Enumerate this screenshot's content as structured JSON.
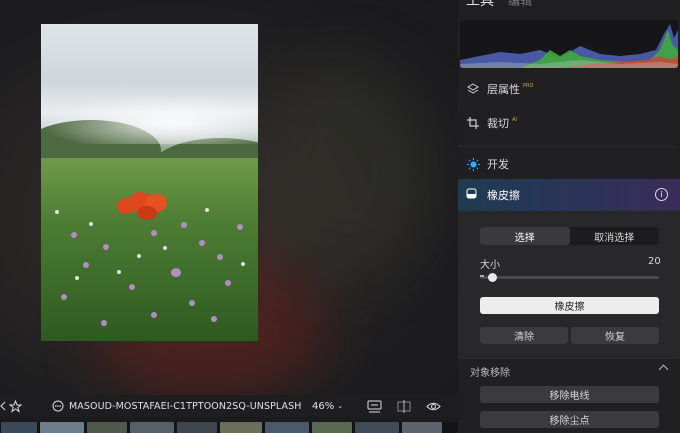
{
  "panel": {
    "title": "工具",
    "subtitle": "编辑",
    "menu": [
      {
        "label": "层属性",
        "badge": "PRO",
        "badge_color": "#d9a638",
        "icon": "layers-icon"
      },
      {
        "label": "裁切",
        "badge": "AI",
        "badge_color": "#d9a638",
        "icon": "crop-icon"
      },
      {
        "label": "开发",
        "badge": "",
        "icon": "sun-icon",
        "icon_color": "#3fa9f5"
      }
    ],
    "eraser": {
      "title": "橡皮擦",
      "icon": "eraser-icon",
      "info_icon": "info-icon",
      "select_tab": "选择",
      "deselect_tab": "取消选择",
      "size_label": "大小",
      "size_value": "20",
      "size_fraction": 0.07,
      "eraser_button": "橡皮擦",
      "clear_button": "清除",
      "restore_button": "恢复"
    },
    "object_removal": {
      "title": "对象移除",
      "remove_wires": "移除电线",
      "remove_dust": "移除尘点"
    }
  },
  "toolbar": {
    "filename": "MASOUD-MOSTAFAEI-C1TPTOON2SQ-UNSPLASH",
    "zoom": "46%",
    "icons": [
      "star-icon",
      "info-dots-icon",
      "compare-icon",
      "split-view-icon",
      "eye-icon"
    ]
  },
  "colors": {
    "accent_blue": "#3fa9f5",
    "gradient_left": "#1f3b52",
    "gradient_right": "#3a2c5a"
  }
}
